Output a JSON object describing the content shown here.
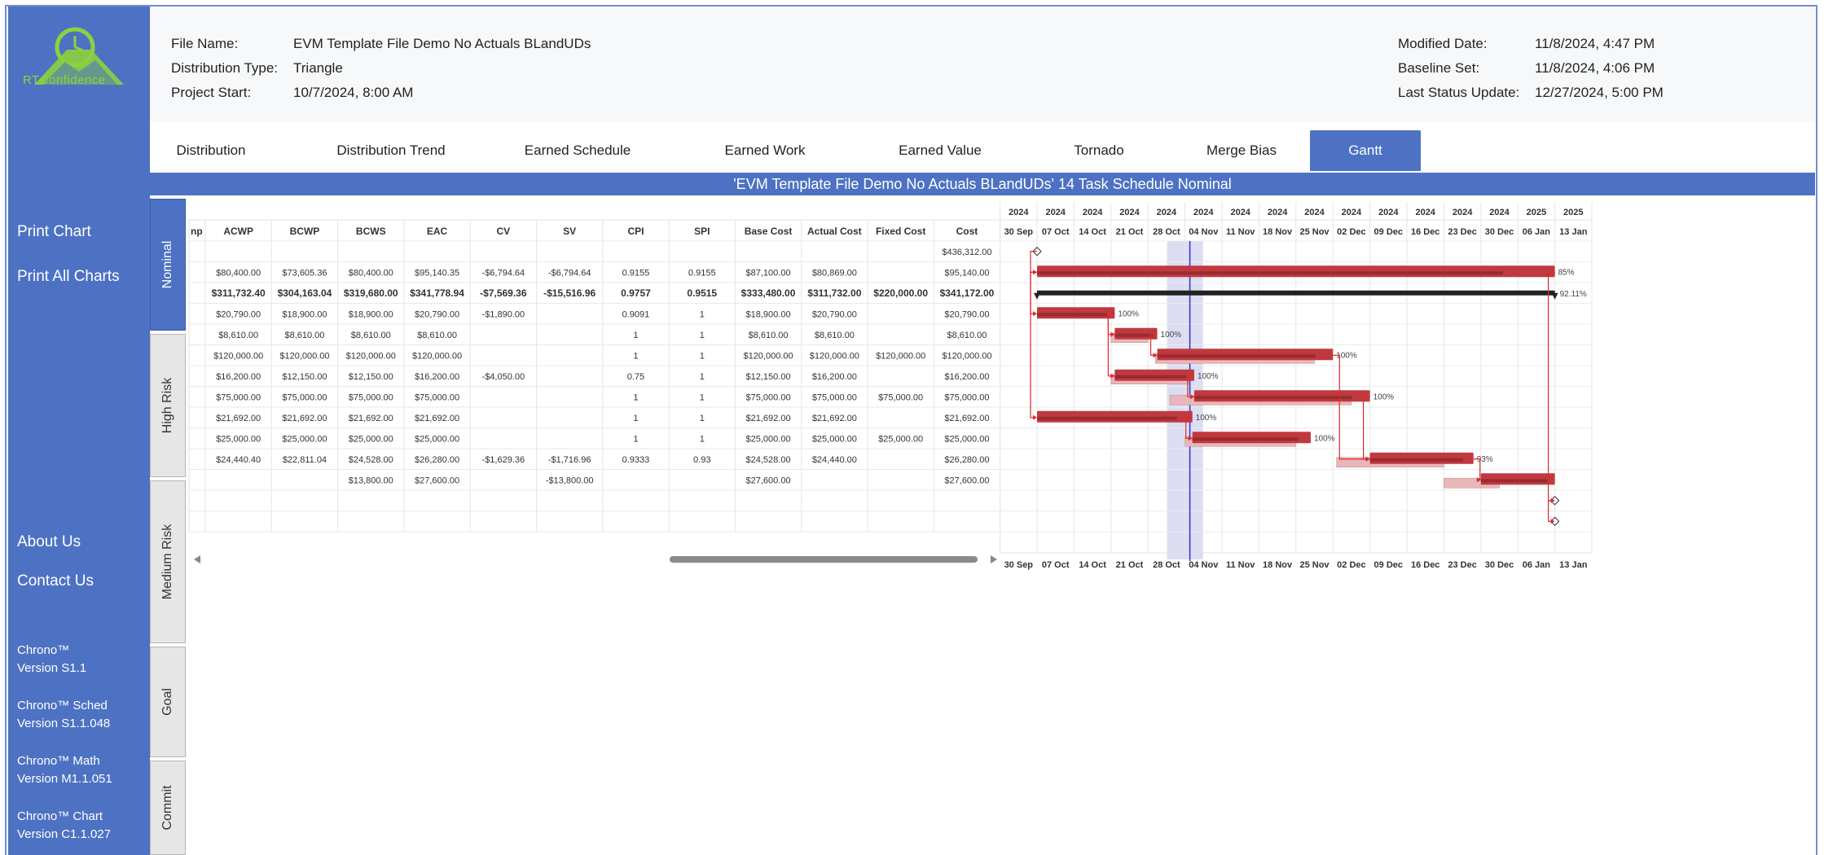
{
  "sidebar": {
    "logo_text": "RTConfidence",
    "links": [
      "Print Chart",
      "Print All Charts",
      "About Us",
      "Contact Us"
    ],
    "versions": [
      {
        "name": "Chrono™",
        "version": "Version S1.1"
      },
      {
        "name": "Chrono™ Sched",
        "version": "Version S1.1.048"
      },
      {
        "name": "Chrono™ Math",
        "version": "Version M1.1.051"
      },
      {
        "name": "Chrono™ Chart",
        "version": "Version C1.1.027"
      }
    ]
  },
  "header": {
    "file_name_label": "File Name:",
    "file_name": "EVM Template File Demo No Actuals BLandUDs",
    "dist_type_label": "Distribution Type:",
    "dist_type": "Triangle",
    "project_start_label": "Project Start:",
    "project_start": "10/7/2024, 8:00 AM",
    "modified_label": "Modified Date:",
    "modified": "11/8/2024, 4:47 PM",
    "baseline_label": "Baseline Set:",
    "baseline": "11/8/2024, 4:06 PM",
    "status_label": "Last Status Update:",
    "status": "12/27/2024, 5:00 PM"
  },
  "tabs": [
    "Distribution",
    "Distribution Trend",
    "Earned Schedule",
    "Earned Work",
    "Earned Value",
    "Tornado",
    "Merge Bias",
    "Gantt"
  ],
  "active_tab": "Gantt",
  "chart_title": "'EVM Template File Demo No Actuals BLandUDs' 14 Task Schedule Nominal",
  "vtabs": [
    "Nominal",
    "High Risk",
    "Medium Risk",
    "Goal",
    "Commit"
  ],
  "table": {
    "clipped_header": "np",
    "columns": [
      "ACWP",
      "BCWP",
      "BCWS",
      "EAC",
      "CV",
      "SV",
      "CPI",
      "SPI",
      "Base Cost",
      "Actual Cost",
      "Fixed Cost",
      "Cost"
    ],
    "rows": [
      [
        "",
        "",
        "",
        "",
        "",
        "",
        "",
        "",
        "",
        "",
        "",
        "$436,312.00"
      ],
      [
        "$80,400.00",
        "$73,605.36",
        "$80,400.00",
        "$95,140.35",
        "-$6,794.64",
        "-$6,794.64",
        "0.9155",
        "0.9155",
        "$87,100.00",
        "$80,869.00",
        "",
        "$95,140.00"
      ],
      [
        "$311,732.40",
        "$304,163.04",
        "$319,680.00",
        "$341,778.94",
        "-$7,569.36",
        "-$15,516.96",
        "0.9757",
        "0.9515",
        "$333,480.00",
        "$311,732.00",
        "$220,000.00",
        "$341,172.00"
      ],
      [
        "$20,790.00",
        "$18,900.00",
        "$18,900.00",
        "$20,790.00",
        "-$1,890.00",
        "",
        "0.9091",
        "1",
        "$18,900.00",
        "$20,790.00",
        "",
        "$20,790.00"
      ],
      [
        "$8,610.00",
        "$8,610.00",
        "$8,610.00",
        "$8,610.00",
        "",
        "",
        "1",
        "1",
        "$8,610.00",
        "$8,610.00",
        "",
        "$8,610.00"
      ],
      [
        "$120,000.00",
        "$120,000.00",
        "$120,000.00",
        "$120,000.00",
        "",
        "",
        "1",
        "1",
        "$120,000.00",
        "$120,000.00",
        "$120,000.00",
        "$120,000.00"
      ],
      [
        "$16,200.00",
        "$12,150.00",
        "$12,150.00",
        "$16,200.00",
        "-$4,050.00",
        "",
        "0.75",
        "1",
        "$12,150.00",
        "$16,200.00",
        "",
        "$16,200.00"
      ],
      [
        "$75,000.00",
        "$75,000.00",
        "$75,000.00",
        "$75,000.00",
        "",
        "",
        "1",
        "1",
        "$75,000.00",
        "$75,000.00",
        "$75,000.00",
        "$75,000.00"
      ],
      [
        "$21,692.00",
        "$21,692.00",
        "$21,692.00",
        "$21,692.00",
        "",
        "",
        "1",
        "1",
        "$21,692.00",
        "$21,692.00",
        "",
        "$21,692.00"
      ],
      [
        "$25,000.00",
        "$25,000.00",
        "$25,000.00",
        "$25,000.00",
        "",
        "",
        "1",
        "1",
        "$25,000.00",
        "$25,000.00",
        "$25,000.00",
        "$25,000.00"
      ],
      [
        "$24,440.40",
        "$22,811.04",
        "$24,528.00",
        "$26,280.00",
        "-$1,629.36",
        "-$1,716.96",
        "0.9333",
        "0.93",
        "$24,528.00",
        "$24,440.00",
        "",
        "$26,280.00"
      ],
      [
        "",
        "",
        "$13,800.00",
        "$27,600.00",
        "",
        "-$13,800.00",
        "",
        "",
        "$27,600.00",
        "",
        "",
        "$27,600.00"
      ],
      [
        "",
        "",
        "",
        "",
        "",
        "",
        "",
        "",
        "",
        "",
        "",
        ""
      ],
      [
        "",
        "",
        "",
        "",
        "",
        "",
        "",
        "",
        "",
        "",
        "",
        ""
      ]
    ]
  },
  "gantt": {
    "years": [
      "2024",
      "2024",
      "2024",
      "2024",
      "2024",
      "2024",
      "2024",
      "2024",
      "2024",
      "2024",
      "2024",
      "2024",
      "2024",
      "2024",
      "2025",
      "2025"
    ],
    "weeks": [
      "30 Sep",
      "07 Oct",
      "14 Oct",
      "21 Oct",
      "28 Oct",
      "04 Nov",
      "11 Nov",
      "18 Nov",
      "25 Nov",
      "02 Dec",
      "09 Dec",
      "16 Dec",
      "23 Dec",
      "30 Dec",
      "06 Jan",
      "13 Jan"
    ],
    "percent_labels": [
      "85%",
      "92.11%",
      "100%",
      "100%",
      "100%",
      "100%",
      "100%",
      "100%",
      "100%",
      "93%"
    ],
    "colors": {
      "bar": "#c0393f",
      "bar_dark": "#9a2a2f",
      "baseline": "#e8b7b9",
      "summary": "#222222",
      "today": "#3333cc",
      "highlight": "#dcdcf3",
      "link": "#e0262c"
    }
  }
}
